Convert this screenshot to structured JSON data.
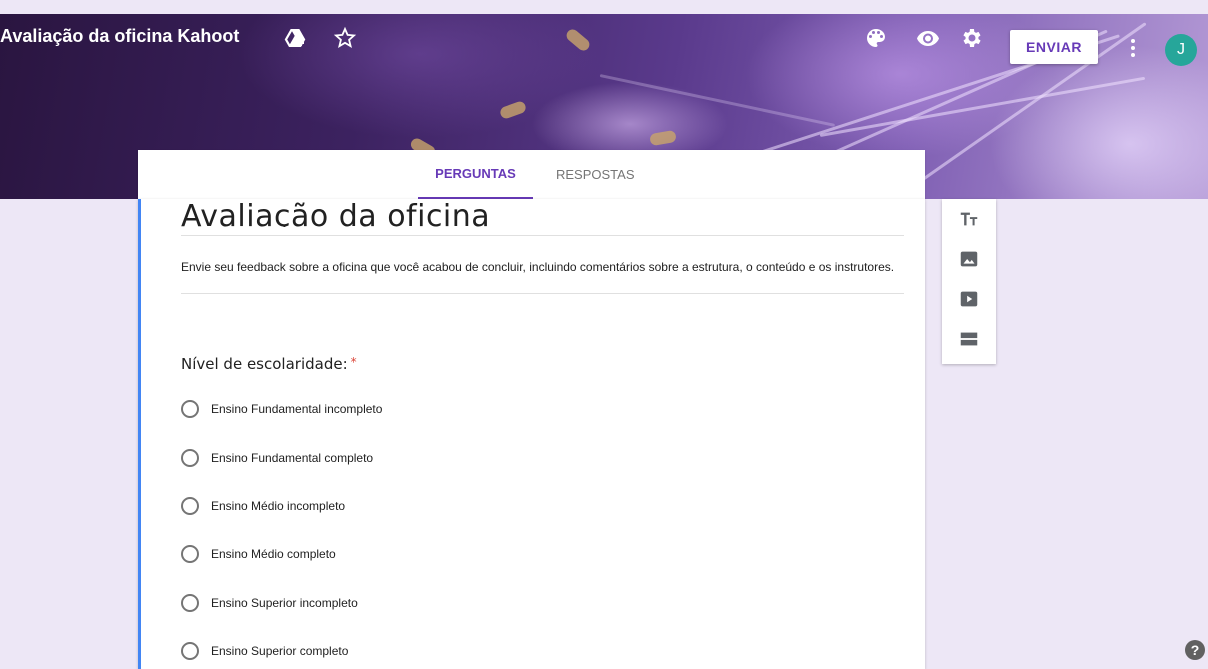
{
  "header": {
    "title": "Avaliação da oficina Kahoot",
    "send_label": "ENVIAR",
    "avatar_initial": "J",
    "icons": [
      "drive-add-icon",
      "star-icon",
      "palette-icon",
      "preview-eye-icon",
      "settings-gear-icon",
      "more-vert-icon"
    ]
  },
  "tabs": [
    {
      "label": "PERGUNTAS",
      "active": true
    },
    {
      "label": "RESPOSTAS",
      "active": false
    }
  ],
  "form": {
    "title": "Avaliação da oficina",
    "description": "Envie seu feedback sobre a oficina que você acabou de concluir, incluindo comentários sobre a estrutura, o conteúdo e os instrutores.",
    "question": {
      "title": "Nível de escolaridade:",
      "required_mark": "*",
      "options": [
        "Ensino Fundamental incompleto",
        "Ensino Fundamental completo",
        "Ensino Médio incompleto",
        "Ensino Médio completo",
        "Ensino Superior incompleto",
        "Ensino Superior completo"
      ]
    }
  },
  "toolbar": {
    "icons": [
      "add-title-icon",
      "add-image-icon",
      "add-video-icon",
      "add-section-icon"
    ]
  },
  "help_label": "?",
  "colors": {
    "accent": "#673ab7",
    "page_bg": "#ede7f6",
    "card_left_border": "#4285f4",
    "required": "#db4437",
    "avatar": "#26a69a"
  }
}
